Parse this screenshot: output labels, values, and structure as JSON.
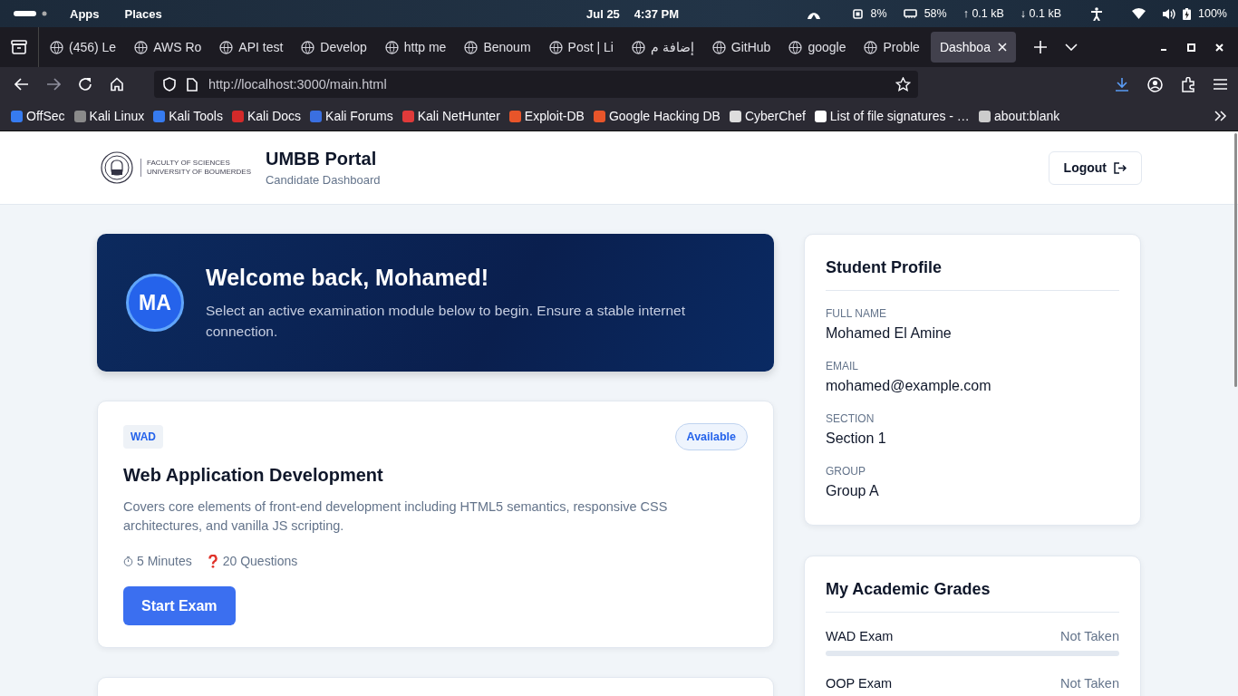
{
  "top_bar": {
    "menus": [
      "Apps",
      "Places"
    ],
    "date": "Jul 25",
    "time": "4:37 PM",
    "cpu": "8%",
    "memory": "58%",
    "upload": "↑ 0.1 kB",
    "download": "↓ 0.1 kB",
    "battery": "100%"
  },
  "tabs": [
    {
      "label": "(456) Le",
      "selected": false
    },
    {
      "label": "AWS Ro",
      "selected": false
    },
    {
      "label": "API test",
      "selected": false
    },
    {
      "label": "Develop",
      "selected": false
    },
    {
      "label": "http me",
      "selected": false
    },
    {
      "label": "Benoum",
      "selected": false
    },
    {
      "label": "Post | Li",
      "selected": false
    },
    {
      "label": "إضافة م",
      "selected": false
    },
    {
      "label": "GitHub",
      "selected": false
    },
    {
      "label": "google",
      "selected": false
    },
    {
      "label": "Proble",
      "selected": false
    },
    {
      "label": "Dashboa",
      "selected": true
    }
  ],
  "url": "http://localhost:3000/main.html",
  "bookmarks": [
    {
      "label": "OffSec",
      "color": "#367bf0"
    },
    {
      "label": "Kali Linux",
      "color": "#8a8a8a"
    },
    {
      "label": "Kali Tools",
      "color": "#367bf0"
    },
    {
      "label": "Kali Docs",
      "color": "#d42a2a"
    },
    {
      "label": "Kali Forums",
      "color": "#3a6fe0"
    },
    {
      "label": "Kali NetHunter",
      "color": "#e03a3a"
    },
    {
      "label": "Exploit-DB",
      "color": "#e8552a"
    },
    {
      "label": "Google Hacking DB",
      "color": "#e8552a"
    },
    {
      "label": "CyberChef",
      "color": "#dddddd"
    },
    {
      "label": "List of file signatures - …",
      "color": "#ffffff"
    },
    {
      "label": "about:blank",
      "color": "#cccccc"
    }
  ],
  "header": {
    "logo_lines": [
      "FACULTY OF SCIENCES",
      "UNIVERSITY OF BOUMERDES"
    ],
    "title": "UMBB Portal",
    "subtitle": "Candidate Dashboard",
    "logout": "Logout"
  },
  "welcome": {
    "initials": "MA",
    "heading": "Welcome back, Mohamed!",
    "text": "Select an active examination module below to begin. Ensure a stable internet connection."
  },
  "exams": [
    {
      "code": "WAD",
      "status": "Available",
      "title": "Web Application Development",
      "description": "Covers core elements of front-end development including HTML5 semantics, responsive CSS architectures, and vanilla JS scripting.",
      "duration": "5 Minutes",
      "questions": "20 Questions",
      "button": "Start Exam"
    }
  ],
  "profile": {
    "title": "Student Profile",
    "fields": [
      {
        "label": "FULL NAME",
        "value": "Mohamed El Amine"
      },
      {
        "label": "EMAIL",
        "value": "mohamed@example.com"
      },
      {
        "label": "SECTION",
        "value": "Section 1"
      },
      {
        "label": "GROUP",
        "value": "Group A"
      }
    ]
  },
  "grades": {
    "title": "My Academic Grades",
    "items": [
      {
        "name": "WAD Exam",
        "status": "Not Taken",
        "level": 0
      },
      {
        "name": "OOP Exam",
        "status": "Not Taken"
      }
    ]
  }
}
